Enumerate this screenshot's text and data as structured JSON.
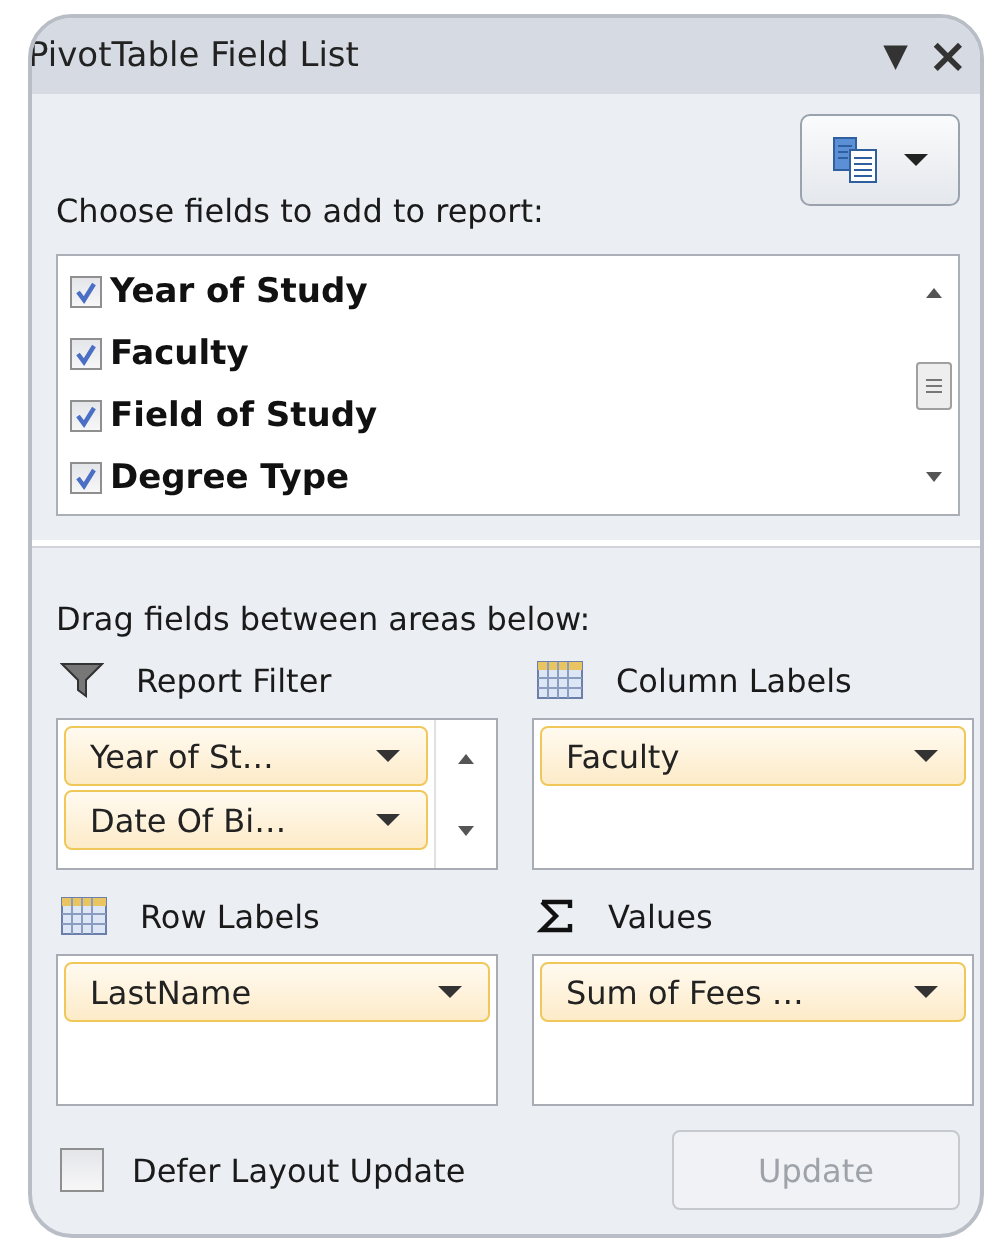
{
  "window": {
    "title": "PivotTable Field List",
    "menu_caret": "▼",
    "close": "×"
  },
  "prompt": "Choose fields to add to report:",
  "fields": [
    {
      "label": "Year of Study",
      "checked": true
    },
    {
      "label": "Faculty",
      "checked": true
    },
    {
      "label": "Field of Study",
      "checked": true
    },
    {
      "label": "Degree Type",
      "checked": true
    }
  ],
  "drag_hint": "Drag fields between areas below:",
  "areas": [
    {
      "label": "Report Filter",
      "kind": "filter",
      "scrollbar": true,
      "items": [
        "Year of St…",
        "Date Of Bi…"
      ]
    },
    {
      "label": "Column Labels",
      "kind": "grid",
      "scrollbar": false,
      "items": [
        "Faculty"
      ]
    },
    {
      "label": "Row Labels",
      "kind": "grid",
      "scrollbar": false,
      "items": [
        "LastName"
      ]
    },
    {
      "label": "Values",
      "kind": "sigma",
      "scrollbar": false,
      "items": [
        "Sum of Fees …"
      ]
    }
  ],
  "defer": {
    "label": "Defer Layout Update",
    "checked": false
  },
  "update_button": {
    "label": "Update",
    "disabled": true
  }
}
